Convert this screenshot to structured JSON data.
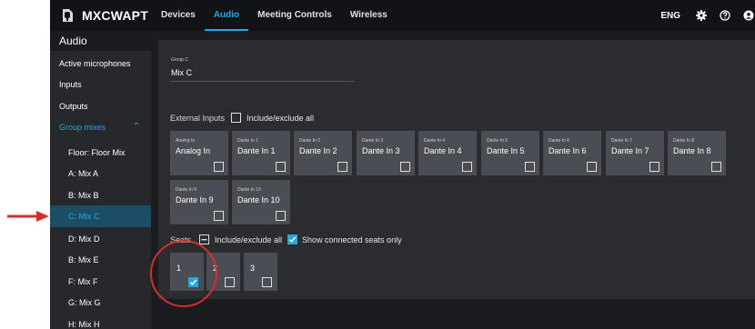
{
  "app": {
    "title": "MXCWAPT",
    "logo_icon": "shure-logo-icon"
  },
  "nav": {
    "items": [
      "Devices",
      "Audio",
      "Meeting Controls",
      "Wireless"
    ],
    "active": "Audio"
  },
  "topbar": {
    "language": "ENG",
    "icons": [
      "gear-icon",
      "help-icon",
      "user-icon"
    ]
  },
  "sidebar": {
    "header": "Audio",
    "items": [
      {
        "label": "Active microphones"
      },
      {
        "label": "Inputs"
      },
      {
        "label": "Outputs"
      },
      {
        "label": "Group mixes"
      },
      {
        "label": "Floor: Floor Mix"
      },
      {
        "label": "A: Mix A"
      },
      {
        "label": "B: Mix B"
      },
      {
        "label": "C: Mix C"
      },
      {
        "label": "D: Mix D"
      },
      {
        "label": "B: Mix E"
      },
      {
        "label": "F: Mix F"
      },
      {
        "label": "G: Mix G"
      },
      {
        "label": "H: Mix H"
      }
    ],
    "selected": "C: Mix C",
    "expand_icon": "chevron-up-icon"
  },
  "group": {
    "label": "Group C",
    "name": "Mix C"
  },
  "external_inputs": {
    "label": "External Inputs",
    "include_all_label": "Include/exclude all",
    "inputs": [
      {
        "small": "Analog In",
        "name": "Analog In",
        "checked": false
      },
      {
        "small": "Dante In 1",
        "name": "Dante In 1",
        "checked": false
      },
      {
        "small": "Dante In 2",
        "name": "Dante In 2",
        "checked": false
      },
      {
        "small": "Dante In 3",
        "name": "Dante In 3",
        "checked": false
      },
      {
        "small": "Dante In 4",
        "name": "Dante In 4",
        "checked": false
      },
      {
        "small": "Dante In 5",
        "name": "Dante In 5",
        "checked": false
      },
      {
        "small": "Dante In 6",
        "name": "Dante In 6",
        "checked": false
      },
      {
        "small": "Dante In 7",
        "name": "Dante In 7",
        "checked": false
      },
      {
        "small": "Dante In 8",
        "name": "Dante In 8",
        "checked": false
      },
      {
        "small": "Dante In 9",
        "name": "Dante In 9",
        "checked": false
      },
      {
        "small": "Dante In 10",
        "name": "Dante In 10",
        "checked": false
      }
    ]
  },
  "seats": {
    "label": "Seats",
    "include_all_label": "Include/exclude all",
    "include_all_state": "partial",
    "show_connected_label": "Show connected seats only",
    "show_connected_checked": true,
    "items": [
      {
        "number": "1",
        "checked": true
      },
      {
        "number": "2",
        "checked": false
      },
      {
        "number": "3",
        "checked": false
      }
    ]
  },
  "colors": {
    "accent": "#27a6e0",
    "annotation": "#d62e2e",
    "selected_row": "#1b4d66",
    "tile": "#4a4d53",
    "panel": "#2a2c30",
    "topbar": "#121316"
  }
}
